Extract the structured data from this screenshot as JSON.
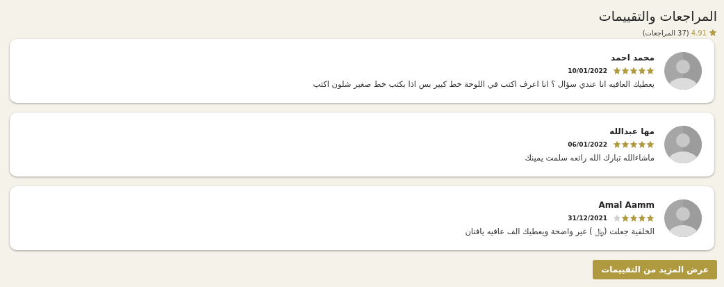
{
  "title": "المراجعات والتقييمات",
  "summary": {
    "score": "4.91",
    "count": "(37 المراجعات)"
  },
  "reviews": [
    {
      "name": "محمد احمد",
      "stars": 5,
      "date": "10/01/2022",
      "text": "يعطيك العافيه انا عندي سؤال ؟ انا اعرف اكتب في اللوحة خط كبير بس اذا بكتب خط صغير شلون اكتب"
    },
    {
      "name": "مها عبدالله",
      "stars": 5,
      "date": "06/01/2022",
      "text": "ماشاءالله تبارك الله رائعه سلمت يمينك"
    },
    {
      "name": "Amal Aamm",
      "stars": 4,
      "date": "31/12/2021",
      "text": "الخلفية جعلت (﷼ ) غير واضحة ويعطيك الف عافيه يافنان"
    }
  ],
  "more_button": "عرض المزيد من التقييمات"
}
